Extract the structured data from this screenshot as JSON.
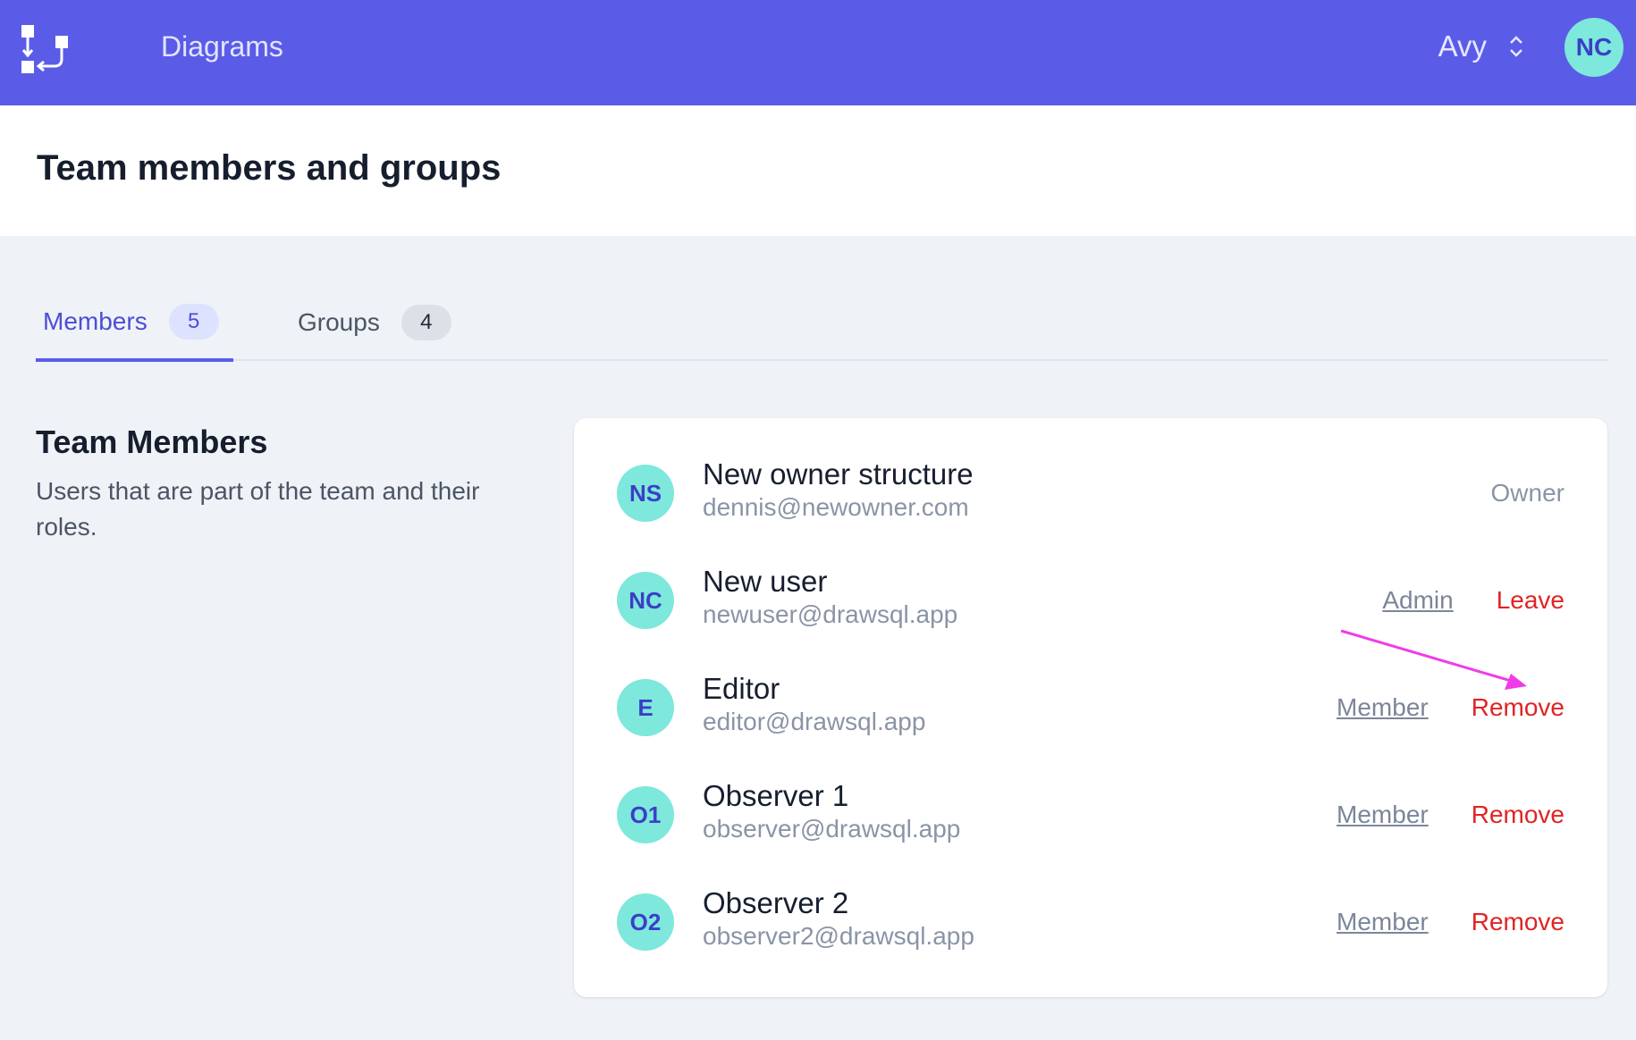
{
  "topbar": {
    "title": "Diagrams",
    "team_name": "Avy",
    "user_initials": "NC",
    "background_color": "#5a5ce8"
  },
  "page": {
    "title": "Team members and groups"
  },
  "tabs": [
    {
      "label": "Members",
      "count": "5",
      "active": true
    },
    {
      "label": "Groups",
      "count": "4",
      "active": false
    }
  ],
  "section": {
    "title": "Team Members",
    "description": "Users that are part of the team and their roles."
  },
  "members": [
    {
      "initials": "NS",
      "name": "New owner structure",
      "email": "dennis@newowner.com",
      "role": "Owner",
      "action": ""
    },
    {
      "initials": "NC",
      "name": "New user",
      "email": "newuser@drawsql.app",
      "role": "Admin",
      "action": "Leave"
    },
    {
      "initials": "E",
      "name": "Editor",
      "email": "editor@drawsql.app",
      "role": "Member",
      "action": "Remove"
    },
    {
      "initials": "O1",
      "name": "Observer 1",
      "email": "observer@drawsql.app",
      "role": "Member",
      "action": "Remove"
    },
    {
      "initials": "O2",
      "name": "Observer 2",
      "email": "observer2@drawsql.app",
      "role": "Member",
      "action": "Remove"
    }
  ],
  "colors": {
    "accent": "#5a5ce8",
    "avatar_bg": "#7de8db",
    "danger": "#e02424",
    "annotation": "#f03ce8"
  },
  "icons": {
    "logo": "diagram-flow-icon",
    "team_switch": "chevron-up-down-icon",
    "annotation": "annotation-arrow-icon"
  }
}
